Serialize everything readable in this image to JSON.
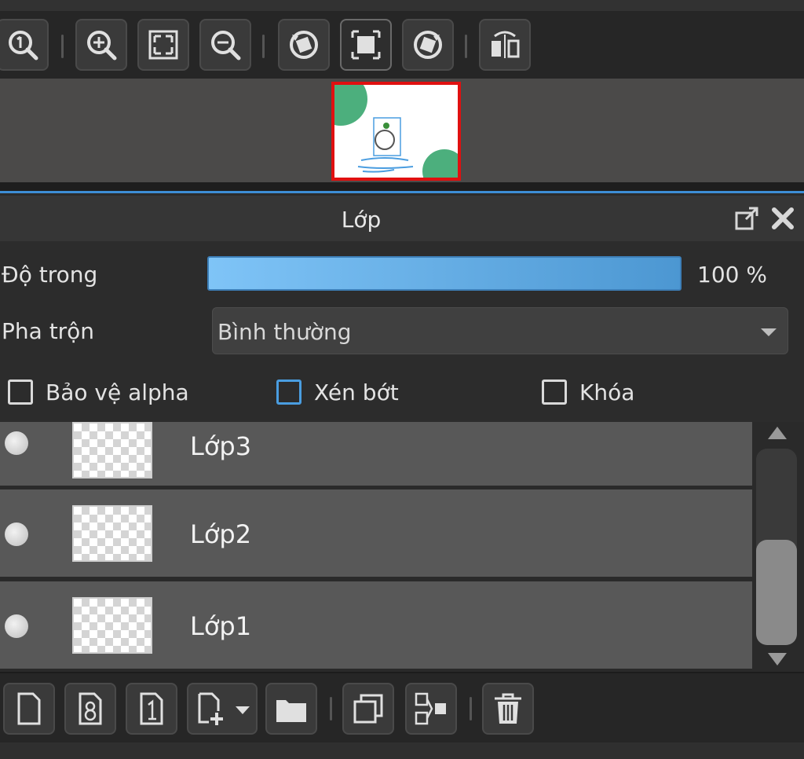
{
  "panel": {
    "title": "Lớp"
  },
  "opacity": {
    "label": "Độ trong",
    "value": "100 %",
    "fraction": 1.0
  },
  "blend": {
    "label": "Pha trộn",
    "value": "Bình thường"
  },
  "options": {
    "protect_alpha": "Bảo vệ alpha",
    "clipping": "Xén bớt",
    "lock": "Khóa"
  },
  "layers": [
    {
      "name": "Lớp3"
    },
    {
      "name": "Lớp2"
    },
    {
      "name": "Lớp1"
    }
  ],
  "colors": {
    "accent": "#3d8ed6",
    "selection_frame": "#e01010",
    "canvas_shape": "#4caf7d"
  },
  "icons": {
    "toolbar": [
      "zoom-actual-icon",
      "zoom-in-icon",
      "fit-screen-icon",
      "zoom-out-icon",
      "rotate-left-icon",
      "fullscreen-icon",
      "rotate-right-icon",
      "flip-icon"
    ],
    "layer_toolbar": [
      "new-layer-icon",
      "new-8bit-layer-icon",
      "new-1bit-layer-icon",
      "add-layer-menu-icon",
      "folder-icon",
      "duplicate-layer-icon",
      "merge-layer-icon",
      "delete-icon"
    ],
    "header": [
      "undock-icon",
      "close-icon"
    ]
  }
}
